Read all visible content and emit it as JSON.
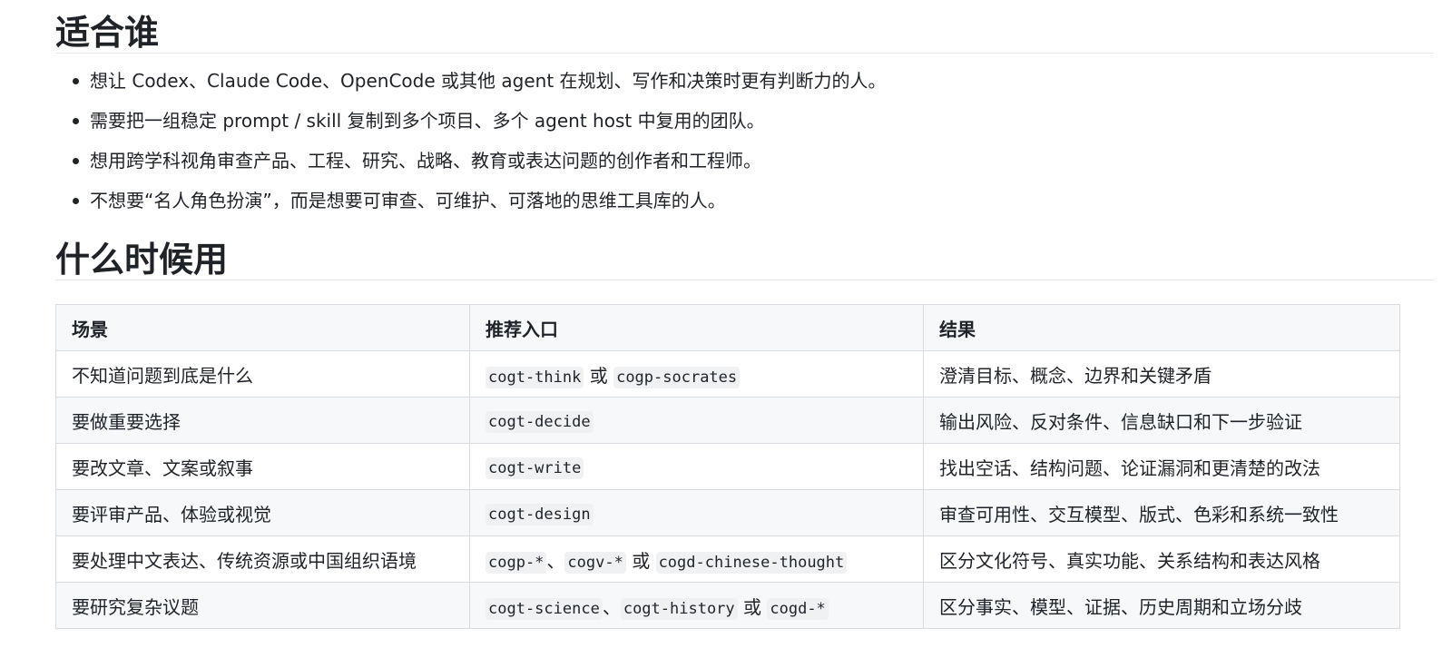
{
  "sections": {
    "who": {
      "title": "适合谁",
      "items": [
        "想让 Codex、Claude Code、OpenCode 或其他 agent 在规划、写作和决策时更有判断力的人。",
        "需要把一组稳定 prompt / skill 复制到多个项目、多个 agent host 中复用的团队。",
        "想用跨学科视角审查产品、工程、研究、战略、教育或表达问题的创作者和工程师。",
        "不想要“名人角色扮演”，而是想要可审查、可维护、可落地的思维工具库的人。"
      ]
    },
    "when": {
      "title": "什么时候用",
      "headers": [
        "场景",
        "推荐入口",
        "结果"
      ],
      "rows": [
        {
          "scene": "不知道问题到底是什么",
          "entry": [
            {
              "code": "cogt-think"
            },
            {
              "text": " 或 "
            },
            {
              "code": "cogp-socrates"
            }
          ],
          "result": "澄清目标、概念、边界和关键矛盾"
        },
        {
          "scene": "要做重要选择",
          "entry": [
            {
              "code": "cogt-decide"
            }
          ],
          "result": "输出风险、反对条件、信息缺口和下一步验证"
        },
        {
          "scene": "要改文章、文案或叙事",
          "entry": [
            {
              "code": "cogt-write"
            }
          ],
          "result": "找出空话、结构问题、论证漏洞和更清楚的改法"
        },
        {
          "scene": "要评审产品、体验或视觉",
          "entry": [
            {
              "code": "cogt-design"
            }
          ],
          "result": "审查可用性、交互模型、版式、色彩和系统一致性"
        },
        {
          "scene": "要处理中文表达、传统资源或中国组织语境",
          "entry": [
            {
              "code": "cogp-*"
            },
            {
              "text": "、"
            },
            {
              "code": "cogv-*"
            },
            {
              "text": " 或 "
            },
            {
              "code": "cogd-chinese-thought"
            }
          ],
          "result": "区分文化符号、真实功能、关系结构和表达风格"
        },
        {
          "scene": "要研究复杂议题",
          "entry": [
            {
              "code": "cogt-science"
            },
            {
              "text": "、"
            },
            {
              "code": "cogt-history"
            },
            {
              "text": " 或 "
            },
            {
              "code": "cogd-*"
            }
          ],
          "result": "区分事实、模型、证据、历史周期和立场分歧"
        }
      ]
    }
  }
}
